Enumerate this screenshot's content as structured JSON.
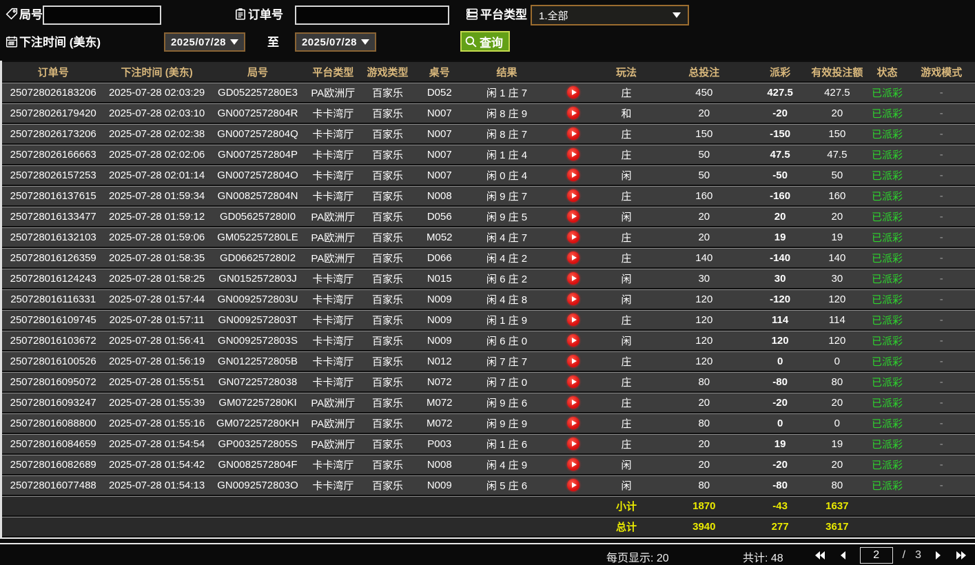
{
  "colors": {
    "header_gold": "#d9b87c",
    "payout_win_red": "#b01f3a",
    "payout_loss_green": "#5ecb0a",
    "status_green": "#2dd42d",
    "totals_yellow": "#ebeb00",
    "search_button_green": "#63a017",
    "picker_border_orange": "#8a6434"
  },
  "filters": {
    "round_label": "局号",
    "round_value": "",
    "order_label": "订单号",
    "order_value": "",
    "platform_label": "平台类型",
    "platform_value": "1.全部",
    "bet_time_label": "下注时间 (美东)",
    "date_from": "2025/07/28",
    "to_label": "至",
    "date_to": "2025/07/28",
    "search_label": "查询"
  },
  "table": {
    "headers": [
      "订单号",
      "下注时间 (美东)",
      "局号",
      "平台类型",
      "游戏类型",
      "桌号",
      "结果",
      "",
      "玩法",
      "总投注",
      "派彩",
      "有效投注额",
      "状态",
      "游戏模式"
    ],
    "rows": [
      {
        "order": "250728026183206",
        "time": "2025-07-28 02:03:29",
        "round": "GD052257280E3",
        "platform": "PA欧洲厅",
        "game": "百家乐",
        "table": "D052",
        "result": "闲 1 庄 7",
        "playtype": "庄",
        "bet": "450",
        "payout": "427.5",
        "payout_class": "pay-pos",
        "valid": "427.5",
        "status": "已派彩",
        "mode": "-"
      },
      {
        "order": "250728026179420",
        "time": "2025-07-28 02:03:10",
        "round": "GN0072572804R",
        "platform": "卡卡湾厅",
        "game": "百家乐",
        "table": "N007",
        "result": "闲 8 庄 9",
        "playtype": "和",
        "bet": "20",
        "payout": "-20",
        "payout_class": "pay-neg",
        "valid": "20",
        "status": "已派彩",
        "mode": "-"
      },
      {
        "order": "250728026173206",
        "time": "2025-07-28 02:02:38",
        "round": "GN0072572804Q",
        "platform": "卡卡湾厅",
        "game": "百家乐",
        "table": "N007",
        "result": "闲 8 庄 7",
        "playtype": "庄",
        "bet": "150",
        "payout": "-150",
        "payout_class": "pay-neg",
        "valid": "150",
        "status": "已派彩",
        "mode": "-"
      },
      {
        "order": "250728026166663",
        "time": "2025-07-28 02:02:06",
        "round": "GN0072572804P",
        "platform": "卡卡湾厅",
        "game": "百家乐",
        "table": "N007",
        "result": "闲 1 庄 4",
        "playtype": "庄",
        "bet": "50",
        "payout": "47.5",
        "payout_class": "pay-pos",
        "valid": "47.5",
        "status": "已派彩",
        "mode": "-"
      },
      {
        "order": "250728026157253",
        "time": "2025-07-28 02:01:14",
        "round": "GN0072572804O",
        "platform": "卡卡湾厅",
        "game": "百家乐",
        "table": "N007",
        "result": "闲 0 庄 4",
        "playtype": "闲",
        "bet": "50",
        "payout": "-50",
        "payout_class": "pay-neg",
        "valid": "50",
        "status": "已派彩",
        "mode": "-"
      },
      {
        "order": "250728016137615",
        "time": "2025-07-28 01:59:34",
        "round": "GN0082572804N",
        "platform": "卡卡湾厅",
        "game": "百家乐",
        "table": "N008",
        "result": "闲 9 庄 7",
        "playtype": "庄",
        "bet": "160",
        "payout": "-160",
        "payout_class": "pay-neg",
        "valid": "160",
        "status": "已派彩",
        "mode": "-"
      },
      {
        "order": "250728016133477",
        "time": "2025-07-28 01:59:12",
        "round": "GD056257280I0",
        "platform": "PA欧洲厅",
        "game": "百家乐",
        "table": "D056",
        "result": "闲 9 庄 5",
        "playtype": "闲",
        "bet": "20",
        "payout": "20",
        "payout_class": "pay-pos",
        "valid": "20",
        "status": "已派彩",
        "mode": "-"
      },
      {
        "order": "250728016132103",
        "time": "2025-07-28 01:59:06",
        "round": "GM052257280LE",
        "platform": "PA欧洲厅",
        "game": "百家乐",
        "table": "M052",
        "result": "闲 4 庄 7",
        "playtype": "庄",
        "bet": "20",
        "payout": "19",
        "payout_class": "pay-pos",
        "valid": "19",
        "status": "已派彩",
        "mode": "-"
      },
      {
        "order": "250728016126359",
        "time": "2025-07-28 01:58:35",
        "round": "GD066257280I2",
        "platform": "PA欧洲厅",
        "game": "百家乐",
        "table": "D066",
        "result": "闲 4 庄 2",
        "playtype": "庄",
        "bet": "140",
        "payout": "-140",
        "payout_class": "pay-neg",
        "valid": "140",
        "status": "已派彩",
        "mode": "-"
      },
      {
        "order": "250728016124243",
        "time": "2025-07-28 01:58:25",
        "round": "GN0152572803J",
        "platform": "卡卡湾厅",
        "game": "百家乐",
        "table": "N015",
        "result": "闲 6 庄 2",
        "playtype": "闲",
        "bet": "30",
        "payout": "30",
        "payout_class": "pay-pos",
        "valid": "30",
        "status": "已派彩",
        "mode": "-"
      },
      {
        "order": "250728016116331",
        "time": "2025-07-28 01:57:44",
        "round": "GN0092572803U",
        "platform": "卡卡湾厅",
        "game": "百家乐",
        "table": "N009",
        "result": "闲 4 庄 8",
        "playtype": "闲",
        "bet": "120",
        "payout": "-120",
        "payout_class": "pay-neg",
        "valid": "120",
        "status": "已派彩",
        "mode": "-"
      },
      {
        "order": "250728016109745",
        "time": "2025-07-28 01:57:11",
        "round": "GN0092572803T",
        "platform": "卡卡湾厅",
        "game": "百家乐",
        "table": "N009",
        "result": "闲 1 庄 9",
        "playtype": "庄",
        "bet": "120",
        "payout": "114",
        "payout_class": "pay-pos",
        "valid": "114",
        "status": "已派彩",
        "mode": "-"
      },
      {
        "order": "250728016103672",
        "time": "2025-07-28 01:56:41",
        "round": "GN0092572803S",
        "platform": "卡卡湾厅",
        "game": "百家乐",
        "table": "N009",
        "result": "闲 6 庄 0",
        "playtype": "闲",
        "bet": "120",
        "payout": "120",
        "payout_class": "pay-pos",
        "valid": "120",
        "status": "已派彩",
        "mode": "-"
      },
      {
        "order": "250728016100526",
        "time": "2025-07-28 01:56:19",
        "round": "GN0122572805B",
        "platform": "卡卡湾厅",
        "game": "百家乐",
        "table": "N012",
        "result": "闲 7 庄 7",
        "playtype": "庄",
        "bet": "120",
        "payout": "0",
        "payout_class": "pay-zero",
        "valid": "0",
        "status": "已派彩",
        "mode": "-"
      },
      {
        "order": "250728016095072",
        "time": "2025-07-28 01:55:51",
        "round": "GN07225728038",
        "platform": "卡卡湾厅",
        "game": "百家乐",
        "table": "N072",
        "result": "闲 7 庄 0",
        "playtype": "庄",
        "bet": "80",
        "payout": "-80",
        "payout_class": "pay-neg",
        "valid": "80",
        "status": "已派彩",
        "mode": "-"
      },
      {
        "order": "250728016093247",
        "time": "2025-07-28 01:55:39",
        "round": "GM072257280KI",
        "platform": "PA欧洲厅",
        "game": "百家乐",
        "table": "M072",
        "result": "闲 9 庄 6",
        "playtype": "庄",
        "bet": "20",
        "payout": "-20",
        "payout_class": "pay-neg",
        "valid": "20",
        "status": "已派彩",
        "mode": "-"
      },
      {
        "order": "250728016088800",
        "time": "2025-07-28 01:55:16",
        "round": "GM072257280KH",
        "platform": "PA欧洲厅",
        "game": "百家乐",
        "table": "M072",
        "result": "闲 9 庄 9",
        "playtype": "庄",
        "bet": "80",
        "payout": "0",
        "payout_class": "pay-zero",
        "valid": "0",
        "status": "已派彩",
        "mode": "-"
      },
      {
        "order": "250728016084659",
        "time": "2025-07-28 01:54:54",
        "round": "GP0032572805S",
        "platform": "PA欧洲厅",
        "game": "百家乐",
        "table": "P003",
        "result": "闲 1 庄 6",
        "playtype": "庄",
        "bet": "20",
        "payout": "19",
        "payout_class": "pay-pos",
        "valid": "19",
        "status": "已派彩",
        "mode": "-"
      },
      {
        "order": "250728016082689",
        "time": "2025-07-28 01:54:42",
        "round": "GN0082572804F",
        "platform": "卡卡湾厅",
        "game": "百家乐",
        "table": "N008",
        "result": "闲 4 庄 9",
        "playtype": "闲",
        "bet": "20",
        "payout": "-20",
        "payout_class": "pay-neg",
        "valid": "20",
        "status": "已派彩",
        "mode": "-"
      },
      {
        "order": "250728016077488",
        "time": "2025-07-28 01:54:13",
        "round": "GN0092572803O",
        "platform": "卡卡湾厅",
        "game": "百家乐",
        "table": "N009",
        "result": "闲 5 庄 6",
        "playtype": "闲",
        "bet": "80",
        "payout": "-80",
        "payout_class": "pay-neg",
        "valid": "80",
        "status": "已派彩",
        "mode": "-"
      }
    ],
    "subtotal": {
      "label": "小计",
      "bet": "1870",
      "payout": "-43",
      "valid": "1637"
    },
    "grand_total": {
      "label": "总计",
      "bet": "3940",
      "payout": "277",
      "valid": "3617"
    }
  },
  "footer": {
    "per_page": "每页显示: 20",
    "total_count": "共计: 48",
    "current_page": "2",
    "page_sep": "/",
    "total_pages": "3"
  }
}
